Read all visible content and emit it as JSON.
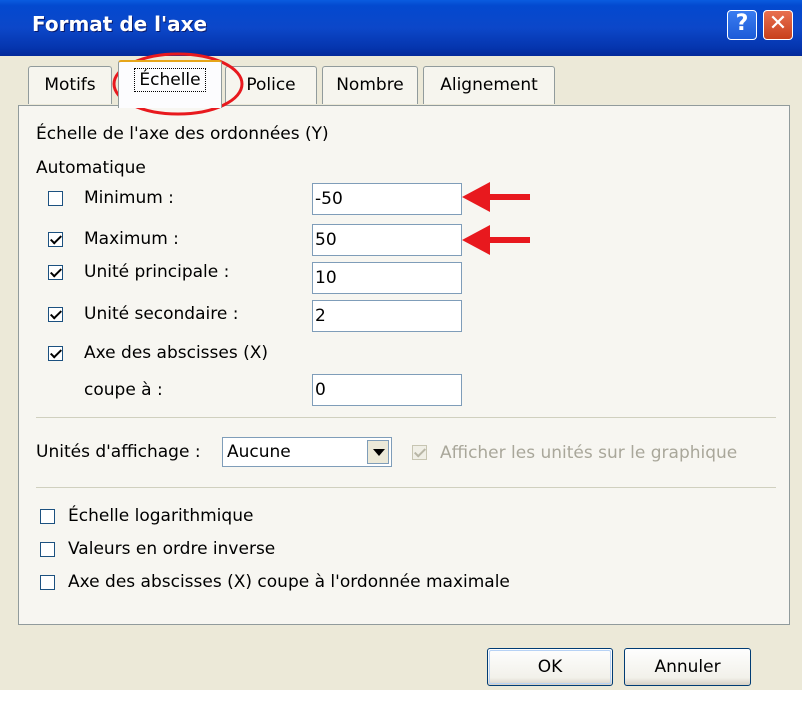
{
  "window": {
    "title": "Format de l'axe",
    "help_label": "?",
    "close_label": "✕"
  },
  "tabs": [
    {
      "label": "Motifs",
      "active": false
    },
    {
      "label": "Échelle",
      "active": true
    },
    {
      "label": "Police",
      "active": false
    },
    {
      "label": "Nombre",
      "active": false
    },
    {
      "label": "Alignement",
      "active": false
    }
  ],
  "scale": {
    "heading": "Échelle de l'axe des ordonnées (Y)",
    "auto_label": "Automatique",
    "rows": [
      {
        "label": "Minimum :",
        "checked": false,
        "value": "-50"
      },
      {
        "label": "Maximum :",
        "checked": true,
        "value": "50"
      },
      {
        "label": "Unité principale :",
        "checked": true,
        "value": "10"
      },
      {
        "label": "Unité secondaire :",
        "checked": true,
        "value": "2"
      }
    ],
    "crosses": {
      "label_line1": "Axe des abscisses (X)",
      "label_line2": "coupe à :",
      "checked": true,
      "value": "0"
    }
  },
  "display_units": {
    "label": "Unités d'affichage :",
    "selected": "Aucune",
    "show_label": "Afficher les unités sur le graphique",
    "show_checked": true
  },
  "options": [
    {
      "label": "Échelle logarithmique",
      "checked": false
    },
    {
      "label": "Valeurs en ordre inverse",
      "checked": false
    },
    {
      "label": "Axe des abscisses (X) coupe à l'ordonnée maximale",
      "checked": false
    }
  ],
  "buttons": {
    "ok": "OK",
    "cancel": "Annuler"
  },
  "colors": {
    "annotation": "#e8191e",
    "titlebar": "#0c47c9"
  }
}
